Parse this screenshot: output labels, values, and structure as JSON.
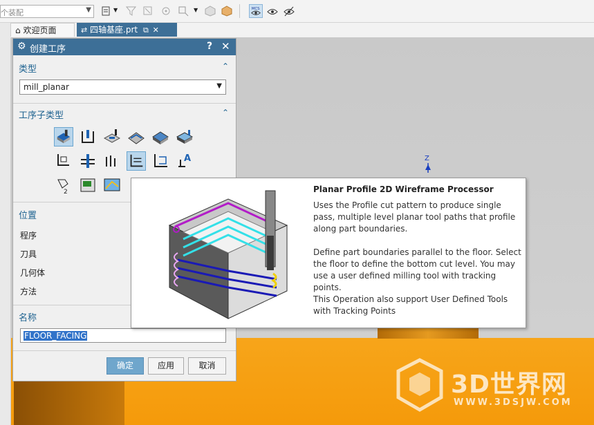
{
  "toolbar": {
    "assembly_combo": "个装配",
    "icons": [
      "selection-filter-icon",
      "filter-off-icon",
      "filter-icon",
      "snap-point-icon",
      "show-hide-icon",
      "shaded-view-icon",
      "mcs-icon",
      "show-icon",
      "hide-icon"
    ]
  },
  "tabs": [
    {
      "label": "欢迎页面",
      "icon": "home-icon"
    },
    {
      "label": "四轴基座.prt",
      "icon": "part-file-icon"
    }
  ],
  "dialog": {
    "title": "创建工序",
    "help": "?",
    "close": "✕",
    "type_section": "类型",
    "type_value": "mill_planar",
    "subtype_section": "工序子类型",
    "subtypes_selected": [
      "floor_wall",
      "planar_profile_2d"
    ],
    "location_section": "位置",
    "location_fields": [
      {
        "label": "程序"
      },
      {
        "label": "刀具"
      },
      {
        "label": "几何体"
      },
      {
        "label": "方法"
      }
    ],
    "name_section": "名称",
    "name_value": "FLOOR_FACING",
    "buttons": {
      "ok": "确定",
      "apply": "应用",
      "cancel": "取消"
    }
  },
  "tooltip": {
    "title": "Planar Profile 2D Wireframe Processor",
    "paragraphs": [
      "Uses the Profile cut pattern to produce single pass, multiple level planar tool paths that profile along part boundaries.",
      "Define part boundaries parallel to the floor. Select the floor to define the bottom cut level. You may use a user defined milling tool with tracking points.",
      "This Operation also support User Defined Tools with Tracking Points"
    ]
  },
  "viewport": {
    "axis_label": "Z"
  },
  "watermark": {
    "text": "3D世界网",
    "url": "WWW.3DSJW.COM"
  },
  "colors": {
    "accent": "#3d6f97",
    "floor": "#f7a51a",
    "selection": "#3173c9"
  }
}
